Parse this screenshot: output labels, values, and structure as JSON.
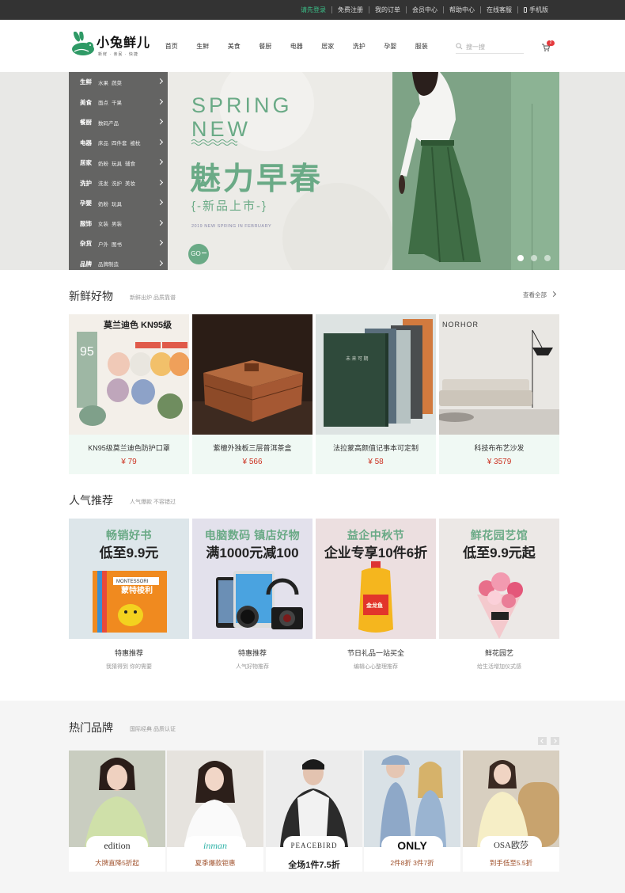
{
  "topbar": {
    "links": [
      "请先登录",
      "免费注册",
      "我的订单",
      "会员中心",
      "帮助中心",
      "在线客服",
      "手机版"
    ]
  },
  "header": {
    "logo_text": "小兔鲜儿",
    "logo_sub": "新鲜 · 亲民 · 快捷",
    "nav": [
      "首页",
      "生鲜",
      "美食",
      "餐厨",
      "电器",
      "居家",
      "洗护",
      "孕婴",
      "服装"
    ],
    "search_placeholder": "搜一搜",
    "cart_count": "2"
  },
  "colors": {
    "accent": "#6aaa86",
    "price": "#cc3322",
    "login": "#3bbf88"
  },
  "sidebar": [
    {
      "title": "生鲜",
      "items": [
        "水果",
        "蔬菜"
      ]
    },
    {
      "title": "美食",
      "items": [
        "面点",
        "干果"
      ]
    },
    {
      "title": "餐厨",
      "items": [
        "数码产品"
      ]
    },
    {
      "title": "电器",
      "items": [
        "床品",
        "四件套",
        "被枕"
      ]
    },
    {
      "title": "居家",
      "items": [
        "奶粉",
        "玩具",
        "辅食"
      ]
    },
    {
      "title": "洗护",
      "items": [
        "洗发",
        "洗护",
        "美妆"
      ]
    },
    {
      "title": "孕婴",
      "items": [
        "奶粉",
        "玩具"
      ]
    },
    {
      "title": "服饰",
      "items": [
        "女装",
        "男装"
      ]
    },
    {
      "title": "杂货",
      "items": [
        "户外",
        "图书"
      ]
    },
    {
      "title": "品牌",
      "items": [
        "品牌制造"
      ]
    }
  ],
  "banner": {
    "line1": "SPRING",
    "line2": "NEW",
    "title": "魅力早春",
    "subtitle": "{-新品上市-}",
    "tiny": "2019 NEW SPRING IN FEBRUARY",
    "go": "GO",
    "slides": 3,
    "active_slide": 0
  },
  "fresh": {
    "title": "新鲜好物",
    "subtitle": "新鲜出炉 品质靠谱",
    "more": "查看全部",
    "products": [
      {
        "name": "KN95级莫兰迪色防护口罩",
        "price": "¥ 79",
        "img_title": "莫兰迪色 KN95级"
      },
      {
        "name": "紫檀外独板三层普洱茶盒",
        "price": "¥ 566"
      },
      {
        "name": "法拉蒙高颜值记事本可定制",
        "price": "¥ 58"
      },
      {
        "name": "科技布布艺沙发",
        "price": "¥ 3579"
      }
    ]
  },
  "popular": {
    "title": "人气推荐",
    "subtitle": "人气爆款 不容错过",
    "items": [
      {
        "h1": "畅销好书",
        "h2": "低至9.9元",
        "caption": "特惠推荐",
        "sub": "我猜得到 你的需要",
        "bg": "#dde6ea"
      },
      {
        "h1": "电脑数码 镇店好物",
        "h2": "满1000元减100",
        "caption": "特惠推荐",
        "sub": "人气好物推荐",
        "bg": "#e3e1ec"
      },
      {
        "h1": "益企中秋节",
        "h2": "企业专享10件6折",
        "caption": "节日礼品一站买全",
        "sub": "编辑心心整理推荐",
        "bg": "#ecdfe0"
      },
      {
        "h1": "鲜花园艺馆",
        "h2": "低至9.9元起",
        "caption": "鲜花园艺",
        "sub": "给生活增加仪式感",
        "bg": "#ece8e6"
      }
    ]
  },
  "brands": {
    "title": "热门品牌",
    "subtitle": "国际经典 品质认证",
    "items": [
      {
        "logo": "edition",
        "caption": "大牌直降5折起",
        "bg": "#cfd6c3"
      },
      {
        "logo": "inman",
        "caption": "夏季爆款钜惠",
        "bg": "#e9e6e1"
      },
      {
        "logo": "PEACEBIRD",
        "caption": "全场1件7.5折",
        "bg": "#ececec"
      },
      {
        "logo": "ONLY",
        "caption": "2件8折 3件7折",
        "bg": "#d9e1e6"
      },
      {
        "logo": "OSA欧莎",
        "caption": "到手低至5.5折",
        "bg": "#d8cfc0"
      }
    ]
  }
}
